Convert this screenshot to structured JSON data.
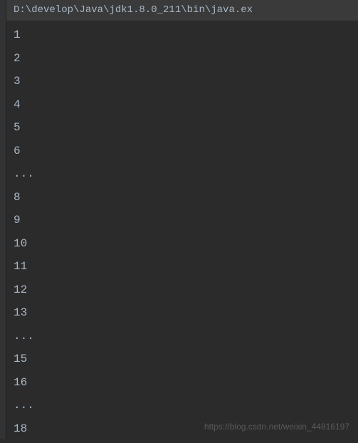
{
  "command": "D:\\develop\\Java\\jdk1.8.0_211\\bin\\java.ex",
  "output_lines": [
    "1",
    "2",
    "3",
    "4",
    "5",
    "6",
    "...",
    "8",
    "9",
    "10",
    "11",
    "12",
    "13",
    "...",
    "15",
    "16",
    "...",
    "18"
  ],
  "watermark": "https://blog.csdn.net/weixin_44816197"
}
